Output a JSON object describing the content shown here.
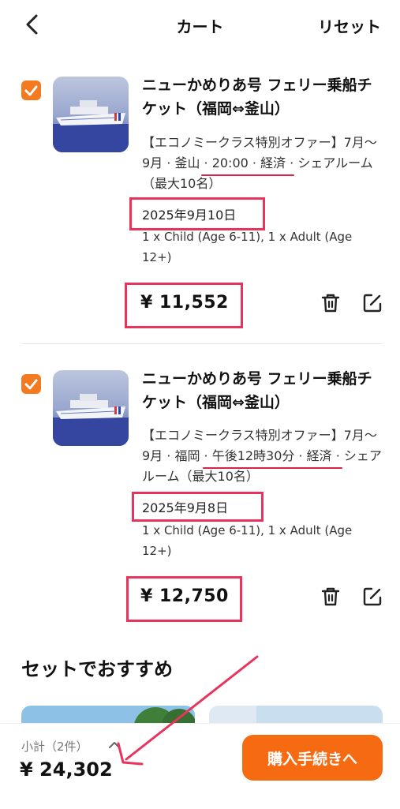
{
  "header": {
    "title": "カート",
    "reset_label": "リセット"
  },
  "items": [
    {
      "title": "ニューかめりあ号 フェリー乗船チケット（福岡⇔釜山）",
      "desc": "【エコノミークラス特別オファー】7月〜9月 · 釜山 · 20:00 · 経済 · シェアルーム（最大10名）",
      "date": "2025年9月10日",
      "passengers": "1 x Child (Age 6-11), 1 x Adult (Age 12+)",
      "price": "¥ 11,552",
      "checked": true
    },
    {
      "title": "ニューかめりあ号 フェリー乗船チケット（福岡⇔釜山）",
      "desc": "【エコノミークラス特別オファー】7月〜9月 · 福岡 · 午後12時30分 · 経済 · シェアルーム（最大10名）",
      "date": "2025年9月8日",
      "passengers": "1 x Child (Age 6-11), 1 x Adult (Age 12+)",
      "price": "¥ 12,750",
      "checked": true
    }
  ],
  "recommend": {
    "title": "セットでおすすめ"
  },
  "footer": {
    "subtotal_label": "小計（2件）",
    "total": "¥ 24,302",
    "checkout_label": "購入手続きへ"
  },
  "colors": {
    "accent": "#f66a12",
    "checkbox": "#f47a1f",
    "annotation": "#e8345d"
  },
  "icons": [
    "chevron-left-icon",
    "check-icon",
    "trash-icon",
    "edit-icon",
    "chevron-up-icon",
    "ferry-photo",
    "arrow-annotation"
  ]
}
